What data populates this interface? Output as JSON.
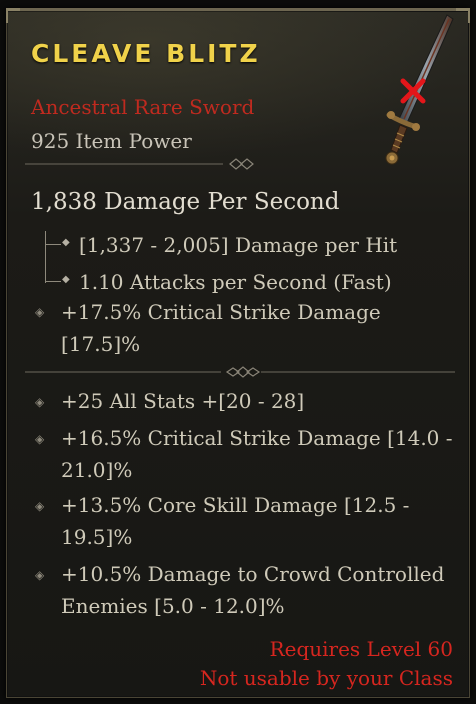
{
  "item": {
    "name": "CLEAVE BLITZ",
    "type": "Ancestral Rare Sword",
    "item_power": "925 Item Power"
  },
  "weapon_stats": {
    "dps": "1,838 Damage Per Second",
    "damage_per_hit": "[1,337 - 2,005] Damage per Hit",
    "attack_speed": "1.10 Attacks per Second (Fast)"
  },
  "implicit_affixes": [
    {
      "text": "+17.5% Critical Strike Damage [17.5]%"
    }
  ],
  "affixes": [
    {
      "text": "+25 All Stats +[20 - 28]"
    },
    {
      "text": "+16.5% Critical Strike Damage [14.0 - 21.0]%"
    },
    {
      "text": "+13.5% Core Skill Damage [12.5 - 19.5]%"
    },
    {
      "text": "+10.5% Damage to Crowd Controlled Enemies [5.0 - 12.0]%"
    }
  ],
  "requirements": {
    "level": "Requires Level 60",
    "class": "Not usable by your Class"
  },
  "colors": {
    "title": "#f0d24a",
    "rarity": "#c02a1f",
    "requirement": "#d6261f",
    "text": "#cfcab9"
  },
  "icons": {
    "item": "sword-icon",
    "unusable": "red-x-icon"
  }
}
